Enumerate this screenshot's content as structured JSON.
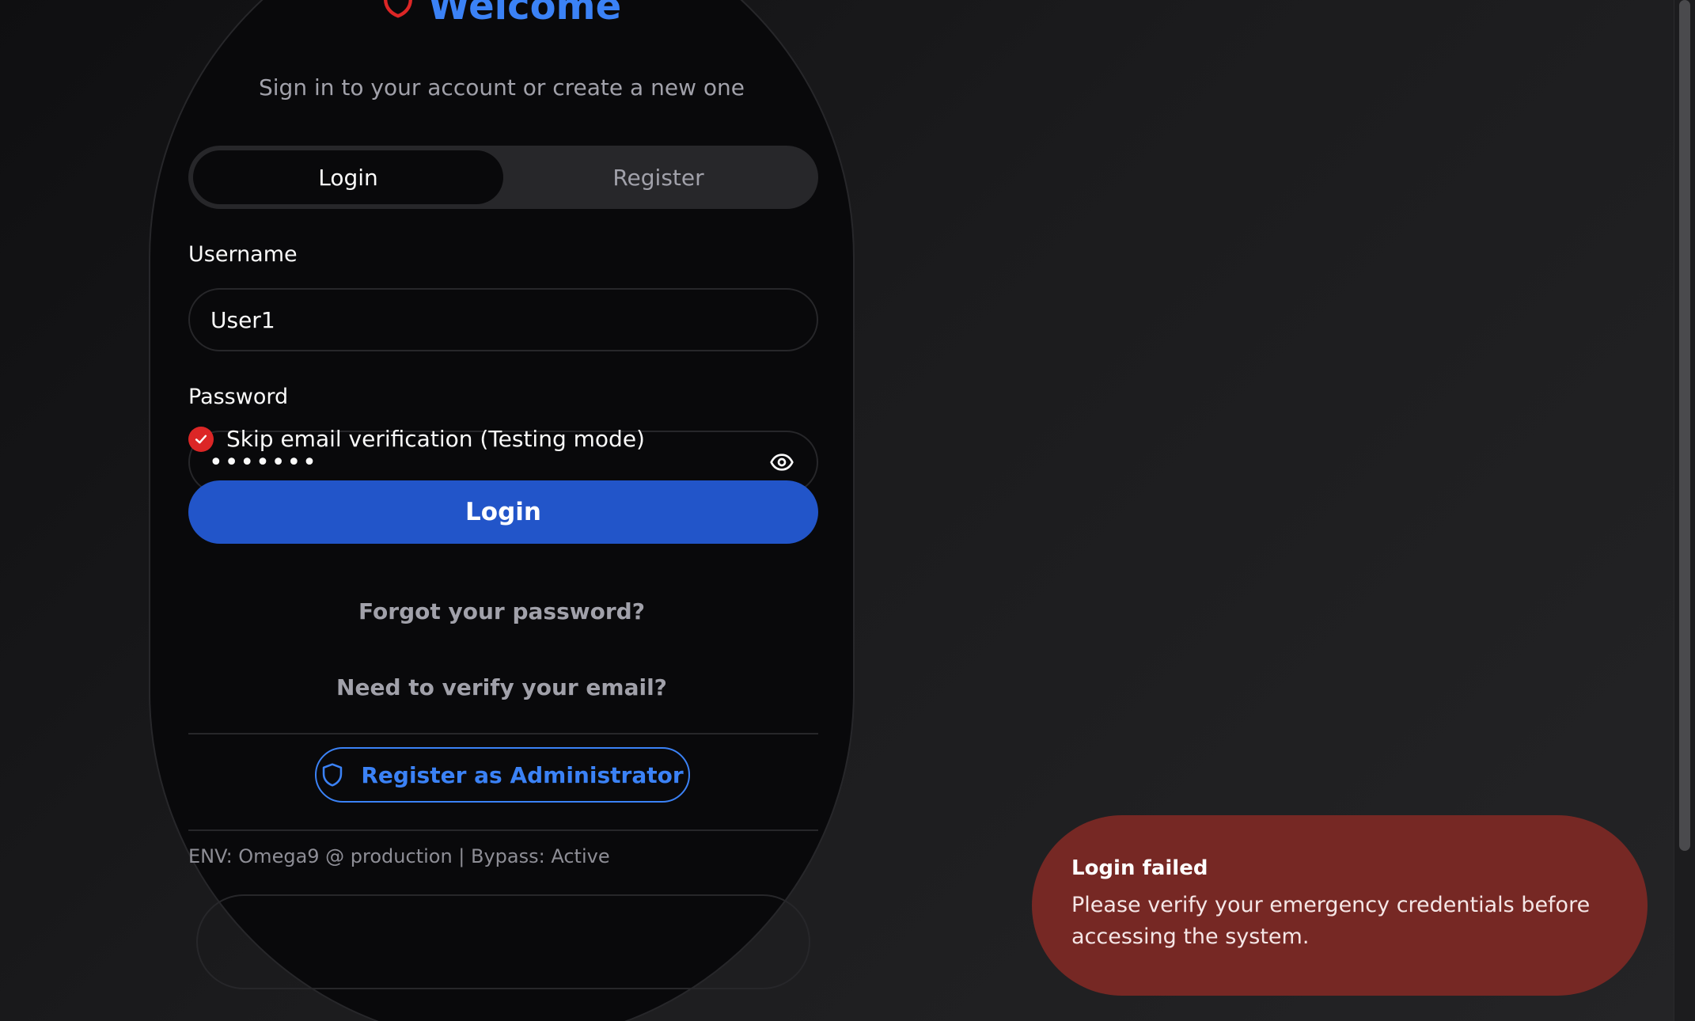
{
  "auth": {
    "title": "Welcome",
    "subtitle": "Sign in to your account or create a new one",
    "tabs": [
      {
        "label": "Login",
        "active": true
      },
      {
        "label": "Register",
        "active": false
      }
    ],
    "username_label": "Username",
    "username_value": "User1",
    "password_label": "Password",
    "password_masked": "•••••••",
    "skip_verification_label": "Skip email verification (Testing mode)",
    "skip_verification_checked": true,
    "login_button": "Login",
    "forgot_password_link": "Forgot your password?",
    "verify_email_link": "Need to verify your email?",
    "register_admin_button": "Register as Administrator",
    "env_info": "ENV: Omega9 @ production | Bypass: Active"
  },
  "toast": {
    "title": "Login failed",
    "message": "Please verify your emergency credentials before accessing the system."
  },
  "colors": {
    "accent": "#3b82f6",
    "login_button": "#2255c9",
    "shield_icon": "#dc2626",
    "checkbox": "#dc2626",
    "toast_background": "#762824"
  },
  "icons": {
    "title": "shield-icon",
    "password_toggle": "eye-icon",
    "checkbox": "check-icon",
    "admin": "shield-icon"
  }
}
